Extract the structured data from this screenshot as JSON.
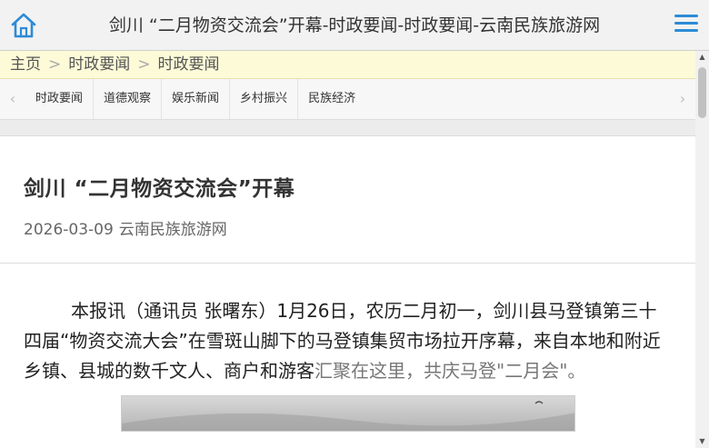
{
  "header": {
    "title": "剑川 “二月物资交流会”开幕-时政要闻-时政要闻-云南民族旅游网",
    "home_icon": "home-icon",
    "menu_icon": "hamburger-menu-icon",
    "accent_color": "#2c8bd6"
  },
  "breadcrumb": {
    "items": [
      "主页",
      "时政要闻",
      "时政要闻"
    ],
    "separator": ">"
  },
  "nav": {
    "tabs": [
      "时政要闻",
      "道德观察",
      "娱乐新闻",
      "乡村振兴",
      "民族经济"
    ],
    "left_arrow": "‹",
    "right_arrow": "›"
  },
  "article": {
    "title": "剑川 “二月物资交流会”开幕",
    "date": "2026-03-09",
    "source": "云南民族旅游网",
    "body_main": "本报讯（通讯员 张曙东）1月26日，农历二月初一，剑川县马登镇第三十四届“物资交流大会”在雪斑山脚下的马登镇集贸市场拉开序幕，来自本地和附近乡镇、县城的数千文人、商户和游客",
    "body_tail": "汇聚在这里，共庆马登\"二月会\"。"
  }
}
